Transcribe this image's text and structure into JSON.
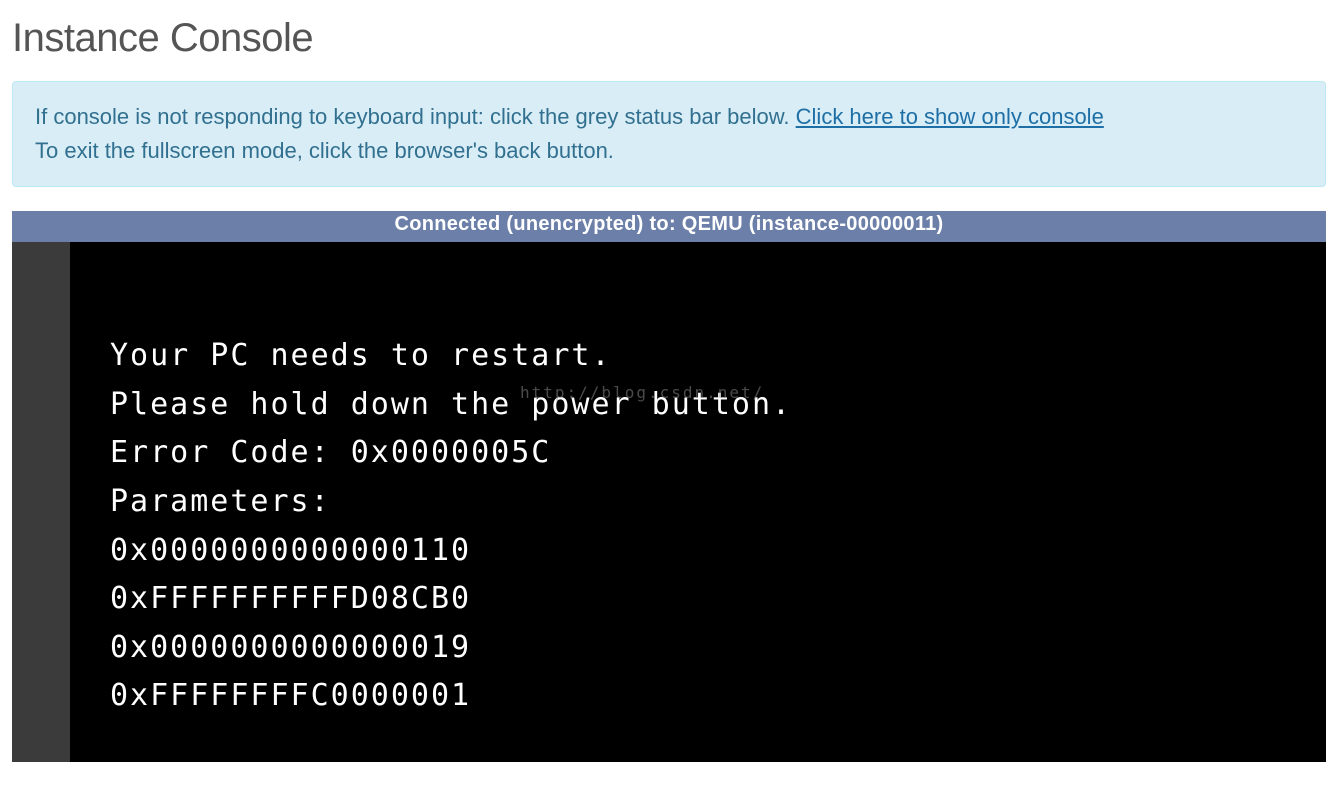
{
  "page": {
    "title": "Instance Console"
  },
  "alert": {
    "pre_link": "If console is not responding to keyboard input: click the grey status bar below. ",
    "link_text": "Click here to show only console",
    "line2": "To exit the fullscreen mode, click the browser's back button."
  },
  "status_bar": {
    "text": "Connected (unencrypted) to: QEMU (instance-00000011)"
  },
  "watermark": {
    "text": "http://blog.csdn.net/"
  },
  "console": {
    "lines": [
      "Your PC needs to restart.",
      "Please hold down the power button.",
      "Error Code: 0x0000005C",
      "Parameters:",
      "0x0000000000000110",
      "0xFFFFFFFFFFD08CB0",
      "0x0000000000000019",
      "0xFFFFFFFFC0000001"
    ]
  }
}
